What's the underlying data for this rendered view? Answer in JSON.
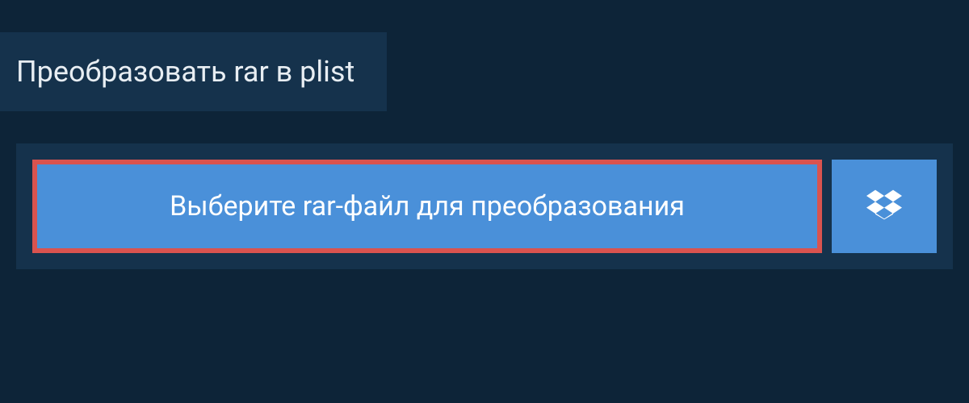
{
  "header": {
    "title": "Преобразовать rar в plist"
  },
  "upload": {
    "select_file_label": "Выберите rar-файл для преобразования"
  },
  "colors": {
    "bg_dark": "#0d2438",
    "bg_panel": "#15324c",
    "button_primary": "#4a90d9",
    "button_border_highlight": "#d9534f",
    "text_light": "#e8eef3",
    "text_white": "#ffffff"
  }
}
